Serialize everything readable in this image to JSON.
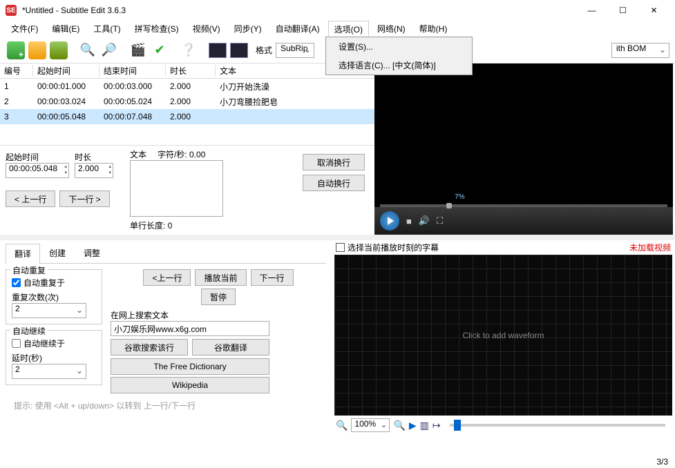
{
  "window": {
    "title": "*Untitled - Subtitle Edit 3.6.3",
    "app_badge": "SE"
  },
  "win_controls": {
    "min": "—",
    "max": "☐",
    "close": "✕"
  },
  "menu": {
    "file": "文件(F)",
    "edit": "编辑(E)",
    "tools": "工具(T)",
    "spell": "拼写检查(S)",
    "video": "视频(V)",
    "sync": "同步(Y)",
    "auto_translate": "自动翻译(A)",
    "options": "选项(O)",
    "network": "网络(N)",
    "help": "帮助(H)"
  },
  "dropdown": {
    "settings": "设置(S)...",
    "language": "选择语言(C)... [中文(简体)]"
  },
  "toolbar": {
    "format_label": "格式",
    "format_value": "SubRip",
    "encoding_value": "ith BOM"
  },
  "columns": {
    "num": "编号",
    "start": "起始时间",
    "end": "结束时间",
    "dur": "时长",
    "text": "文本"
  },
  "rows": [
    {
      "n": "1",
      "s": "00:00:01.000",
      "e": "00:00:03.000",
      "d": "2.000",
      "t": "小刀开始洗澡"
    },
    {
      "n": "2",
      "s": "00:00:03.024",
      "e": "00:00:05.024",
      "d": "2.000",
      "t": "小刀弯腰捡肥皂"
    },
    {
      "n": "3",
      "s": "00:00:05.048",
      "e": "00:00:07.048",
      "d": "2.000",
      "t": ""
    }
  ],
  "edit": {
    "start_label": "起始时间",
    "dur_label": "时长",
    "text_label": "文本",
    "start_value": "00:00:05.048",
    "dur_value": "2.000",
    "cps": "字符/秒: 0.00",
    "linelen": "单行长度: 0",
    "prev_line": "< 上一行",
    "next_line": "下一行 >",
    "unbreak": "取消换行",
    "autobreak": "自动换行"
  },
  "video": {
    "pos_label": "7%"
  },
  "tabs": {
    "translate": "翻译",
    "create": "创建",
    "adjust": "调整"
  },
  "autorepeat": {
    "legend": "自动重复",
    "on": "自动重复于",
    "count_label": "重复次数(次)",
    "count_value": "2"
  },
  "autocontinue": {
    "legend": "自动继续",
    "on": "自动继续于",
    "delay_label": "延时(秒)",
    "delay_value": "2"
  },
  "playback": {
    "prev": "<上一行",
    "play": "播放当前",
    "next": "下一行",
    "pause": "暂停"
  },
  "search": {
    "label": "在网上搜索文本",
    "value": "小刀娱乐网www.x6g.com",
    "google_line": "谷歌搜索该行",
    "google_trans": "谷歌翻译",
    "freedict": "The Free Dictionary",
    "wikipedia": "Wikipedia"
  },
  "hint": "提示: 使用 <Alt + up/down> 以转到 上一行/下一行",
  "wave": {
    "select_label": "选择当前播放时刻的字幕",
    "novideo": "未加载视频",
    "click": "Click to add waveform",
    "zoom": "100%"
  },
  "status": {
    "pos": "3/3"
  }
}
